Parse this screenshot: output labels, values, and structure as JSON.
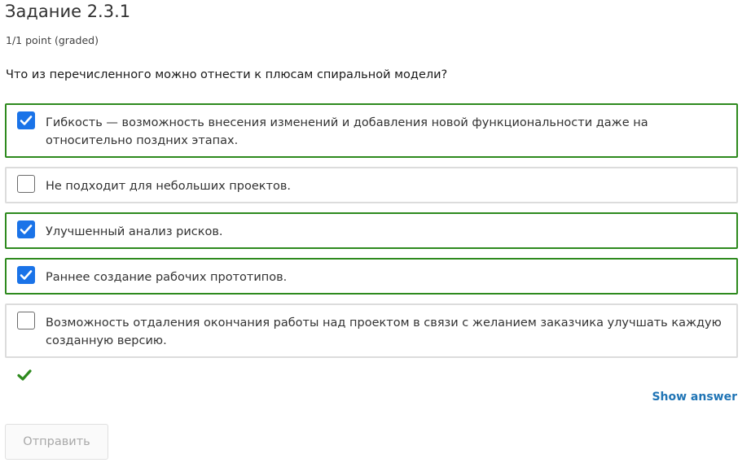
{
  "problem": {
    "title": "Задание 2.3.1",
    "points": "1/1 point (graded)",
    "question": "Что из перечисленного можно отнести к плюсам спиральной модели?"
  },
  "options": [
    {
      "text": "Гибкость — возможность внесения изменений и добавления новой функциональности даже на относительно поздних этапах.",
      "checked": true
    },
    {
      "text": "Не подходит для небольших проектов.",
      "checked": false
    },
    {
      "text": "Улучшенный анализ рисков.",
      "checked": true
    },
    {
      "text": "Раннее создание рабочих прототипов.",
      "checked": true
    },
    {
      "text": "Возможность отдаления окончания работы над проектом в связи с желанием заказчика улучшать каждую созданную версию.",
      "checked": false
    }
  ],
  "status": {
    "icon": "checkmark-icon",
    "color": "#2e8a1e"
  },
  "actions": {
    "show_answer_label": "Show answer",
    "submit_label": "Отправить"
  },
  "colors": {
    "correct_border": "#2e8a1e",
    "checkbox_checked": "#1a73e8",
    "link": "#1f74b5"
  }
}
